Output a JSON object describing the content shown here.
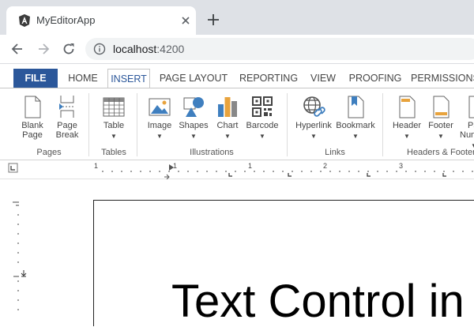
{
  "browser": {
    "tab_title": "MyEditorApp",
    "url_host": "localhost",
    "url_port": ":4200"
  },
  "ribbon": {
    "tabs": [
      "FILE",
      "HOME",
      "INSERT",
      "PAGE LAYOUT",
      "REPORTING",
      "VIEW",
      "PROOFING",
      "PERMISSIONS"
    ],
    "active_tab": "INSERT",
    "groups": {
      "pages": "Pages",
      "tables": "Tables",
      "illustrations": "Illustrations",
      "links": "Links",
      "headers_footers": "Headers & Footers"
    },
    "buttons": {
      "blank_page": [
        "Blank",
        "Page"
      ],
      "page_break": [
        "Page",
        "Break"
      ],
      "table": "Table",
      "image": "Image",
      "shapes": "Shapes",
      "chart": "Chart",
      "barcode": "Barcode",
      "hyperlink": "Hyperlink",
      "bookmark": "Bookmark",
      "header": "Header",
      "footer": "Footer",
      "page_number": [
        "Page",
        "Number"
      ]
    },
    "dropdown_glyph": "▼"
  },
  "ruler": {
    "labels": [
      "1",
      "1",
      "1",
      "2",
      "3"
    ]
  },
  "document": {
    "text": "Text Control in"
  }
}
